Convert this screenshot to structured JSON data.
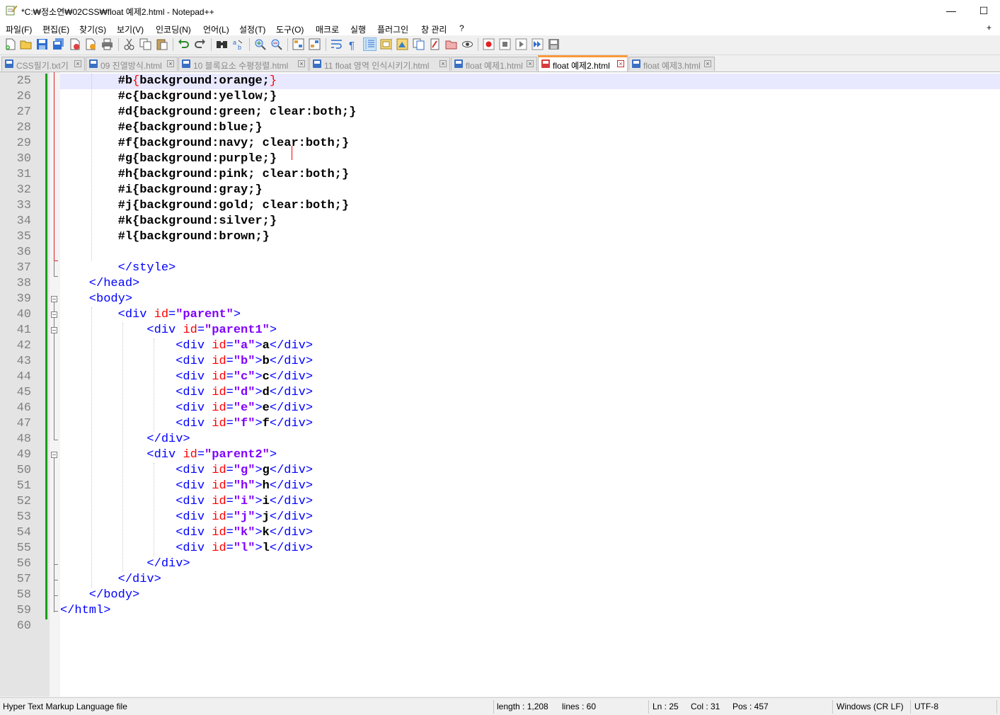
{
  "window": {
    "title": "*C:₩정소연₩02CSS₩float 예제2.html - Notepad++",
    "minimize": "—",
    "maximize": "☐"
  },
  "menu": [
    "파일(F)",
    "편집(E)",
    "찾기(S)",
    "보기(V)",
    "인코딩(N)",
    "언어(L)",
    "설정(T)",
    "도구(O)",
    "매크로",
    "실행",
    "플러그인",
    "창 관리",
    "?"
  ],
  "menu_extra": "+",
  "toolbar_icons": [
    "new-file-icon",
    "open-file-icon",
    "save-icon",
    "save-all-icon",
    "close-icon",
    "close-all-icon",
    "print-icon",
    "cut-icon",
    "copy-icon",
    "paste-icon",
    "undo-icon",
    "redo-icon",
    "find-icon",
    "replace-icon",
    "zoom-in-icon",
    "zoom-out-icon",
    "sync-vertical-icon",
    "sync-horizontal-icon",
    "word-wrap-icon",
    "show-all-chars-icon",
    "indent-guide-icon",
    "udl-icon",
    "doc-map-icon",
    "function-list-icon",
    "folder-workspace-icon",
    "monitor-icon",
    "record-macro-icon",
    "stop-macro-icon",
    "play-macro-icon",
    "run-macro-multiple-icon",
    "save-macro-icon"
  ],
  "tabs": [
    {
      "label": "CSS필기.txt기",
      "active": false
    },
    {
      "label": "09 진열방식.html",
      "active": false
    },
    {
      "label": "10 블록요소 수평정렬.html",
      "active": false
    },
    {
      "label": "11 float 영역 인식시키기.html",
      "active": false
    },
    {
      "label": "float 예제1.html",
      "active": false
    },
    {
      "label": "float 예제2.html",
      "active": true
    },
    {
      "label": "float 예제3.html",
      "active": false
    }
  ],
  "editor": {
    "lines": [
      {
        "n": "25",
        "t": [
          [
            "k",
            "        #b"
          ],
          [
            "b",
            "{"
          ],
          [
            "k",
            "background:orange;"
          ],
          [
            "b",
            "}"
          ]
        ]
      },
      {
        "n": "26",
        "t": [
          [
            "k",
            "        #c{background:yellow;}"
          ]
        ]
      },
      {
        "n": "27",
        "t": [
          [
            "k",
            "        #d{background:green; clear:both;}"
          ]
        ]
      },
      {
        "n": "28",
        "t": [
          [
            "k",
            "        #e{background:blue;}"
          ]
        ]
      },
      {
        "n": "29",
        "t": [
          [
            "k",
            "        #f{background:navy; clear:both;}"
          ]
        ]
      },
      {
        "n": "30",
        "t": [
          [
            "k",
            "        #g{background:purple;}"
          ]
        ]
      },
      {
        "n": "31",
        "t": [
          [
            "k",
            "        #h{background:pink; clear:both;}"
          ]
        ]
      },
      {
        "n": "32",
        "t": [
          [
            "k",
            "        #i{background:gray;}"
          ]
        ]
      },
      {
        "n": "33",
        "t": [
          [
            "k",
            "        #j{background:gold; clear:both;}"
          ]
        ]
      },
      {
        "n": "34",
        "t": [
          [
            "k",
            "        #k{background:silver;}"
          ]
        ]
      },
      {
        "n": "35",
        "t": [
          [
            "k",
            "        #l{background:brown;}"
          ]
        ]
      },
      {
        "n": "36",
        "t": []
      },
      {
        "n": "37",
        "t": [
          [
            "t",
            "        </style>"
          ]
        ]
      },
      {
        "n": "38",
        "t": [
          [
            "t",
            "    </head>"
          ]
        ]
      },
      {
        "n": "39",
        "t": [
          [
            "t",
            "    <body>"
          ]
        ]
      },
      {
        "n": "40",
        "t": [
          [
            "t",
            "        <div "
          ],
          [
            "a",
            "id"
          ],
          [
            "t",
            "="
          ],
          [
            "v",
            "\"parent\""
          ],
          [
            "t",
            ">"
          ]
        ]
      },
      {
        "n": "41",
        "t": [
          [
            "t",
            "            <div "
          ],
          [
            "a",
            "id"
          ],
          [
            "t",
            "="
          ],
          [
            "v",
            "\"parent1\""
          ],
          [
            "t",
            ">"
          ]
        ]
      },
      {
        "n": "42",
        "t": [
          [
            "t",
            "                <div "
          ],
          [
            "a",
            "id"
          ],
          [
            "t",
            "="
          ],
          [
            "v",
            "\"a\""
          ],
          [
            "t",
            ">"
          ],
          [
            "k",
            "a"
          ],
          [
            "t",
            "</div>"
          ]
        ]
      },
      {
        "n": "43",
        "t": [
          [
            "t",
            "                <div "
          ],
          [
            "a",
            "id"
          ],
          [
            "t",
            "="
          ],
          [
            "v",
            "\"b\""
          ],
          [
            "t",
            ">"
          ],
          [
            "k",
            "b"
          ],
          [
            "t",
            "</div>"
          ]
        ]
      },
      {
        "n": "44",
        "t": [
          [
            "t",
            "                <div "
          ],
          [
            "a",
            "id"
          ],
          [
            "t",
            "="
          ],
          [
            "v",
            "\"c\""
          ],
          [
            "t",
            ">"
          ],
          [
            "k",
            "c"
          ],
          [
            "t",
            "</div>"
          ]
        ]
      },
      {
        "n": "45",
        "t": [
          [
            "t",
            "                <div "
          ],
          [
            "a",
            "id"
          ],
          [
            "t",
            "="
          ],
          [
            "v",
            "\"d\""
          ],
          [
            "t",
            ">"
          ],
          [
            "k",
            "d"
          ],
          [
            "t",
            "</div>"
          ]
        ]
      },
      {
        "n": "46",
        "t": [
          [
            "t",
            "                <div "
          ],
          [
            "a",
            "id"
          ],
          [
            "t",
            "="
          ],
          [
            "v",
            "\"e\""
          ],
          [
            "t",
            ">"
          ],
          [
            "k",
            "e"
          ],
          [
            "t",
            "</div>"
          ]
        ]
      },
      {
        "n": "47",
        "t": [
          [
            "t",
            "                <div "
          ],
          [
            "a",
            "id"
          ],
          [
            "t",
            "="
          ],
          [
            "v",
            "\"f\""
          ],
          [
            "t",
            ">"
          ],
          [
            "k",
            "f"
          ],
          [
            "t",
            "</div>"
          ]
        ]
      },
      {
        "n": "48",
        "t": [
          [
            "t",
            "            </div>"
          ]
        ]
      },
      {
        "n": "49",
        "t": [
          [
            "t",
            "            <div "
          ],
          [
            "a",
            "id"
          ],
          [
            "t",
            "="
          ],
          [
            "v",
            "\"parent2\""
          ],
          [
            "t",
            ">"
          ]
        ]
      },
      {
        "n": "50",
        "t": [
          [
            "t",
            "                <div "
          ],
          [
            "a",
            "id"
          ],
          [
            "t",
            "="
          ],
          [
            "v",
            "\"g\""
          ],
          [
            "t",
            ">"
          ],
          [
            "k",
            "g"
          ],
          [
            "t",
            "</div>"
          ]
        ]
      },
      {
        "n": "51",
        "t": [
          [
            "t",
            "                <div "
          ],
          [
            "a",
            "id"
          ],
          [
            "t",
            "="
          ],
          [
            "v",
            "\"h\""
          ],
          [
            "t",
            ">"
          ],
          [
            "k",
            "h"
          ],
          [
            "t",
            "</div>"
          ]
        ]
      },
      {
        "n": "52",
        "t": [
          [
            "t",
            "                <div "
          ],
          [
            "a",
            "id"
          ],
          [
            "t",
            "="
          ],
          [
            "v",
            "\"i\""
          ],
          [
            "t",
            ">"
          ],
          [
            "k",
            "i"
          ],
          [
            "t",
            "</div>"
          ]
        ]
      },
      {
        "n": "53",
        "t": [
          [
            "t",
            "                <div "
          ],
          [
            "a",
            "id"
          ],
          [
            "t",
            "="
          ],
          [
            "v",
            "\"j\""
          ],
          [
            "t",
            ">"
          ],
          [
            "k",
            "j"
          ],
          [
            "t",
            "</div>"
          ]
        ]
      },
      {
        "n": "54",
        "t": [
          [
            "t",
            "                <div "
          ],
          [
            "a",
            "id"
          ],
          [
            "t",
            "="
          ],
          [
            "v",
            "\"k\""
          ],
          [
            "t",
            ">"
          ],
          [
            "k",
            "k"
          ],
          [
            "t",
            "</div>"
          ]
        ]
      },
      {
        "n": "55",
        "t": [
          [
            "t",
            "                <div "
          ],
          [
            "a",
            "id"
          ],
          [
            "t",
            "="
          ],
          [
            "v",
            "\"l\""
          ],
          [
            "t",
            ">"
          ],
          [
            "k",
            "l"
          ],
          [
            "t",
            "</div>"
          ]
        ]
      },
      {
        "n": "56",
        "t": [
          [
            "t",
            "            </div>"
          ]
        ]
      },
      {
        "n": "57",
        "t": [
          [
            "t",
            "        </div>"
          ]
        ]
      },
      {
        "n": "58",
        "t": [
          [
            "t",
            "    </body>"
          ]
        ]
      },
      {
        "n": "59",
        "t": [
          [
            "t",
            "</html>"
          ]
        ]
      },
      {
        "n": "60",
        "t": []
      }
    ]
  },
  "status": {
    "file_type": "Hyper Text Markup Language file",
    "length": "length : 1,208",
    "lines": "lines : 60",
    "ln": "Ln : 25",
    "col": "Col : 31",
    "pos": "Pos : 457",
    "eol": "Windows (CR LF)",
    "encoding": "UTF-8"
  }
}
